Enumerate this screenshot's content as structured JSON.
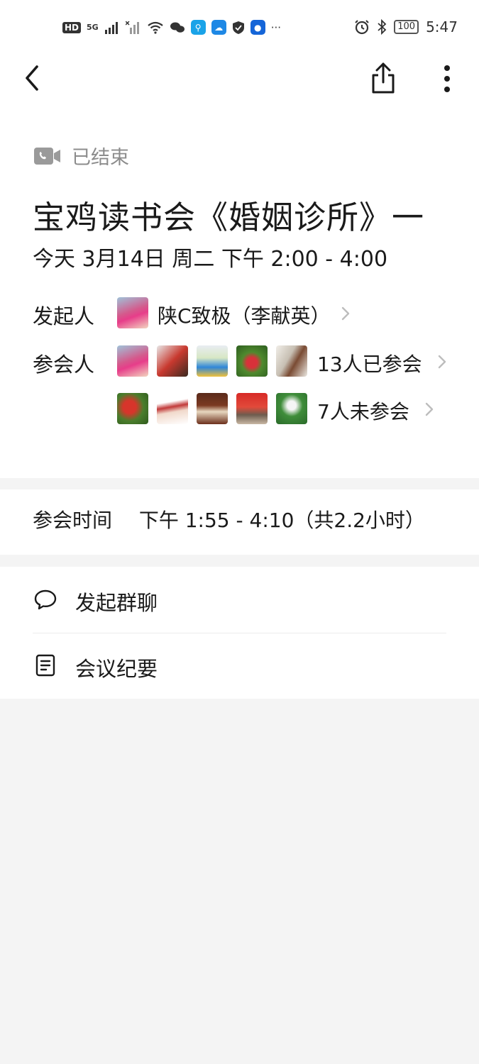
{
  "status_bar": {
    "hd": "HD",
    "signal": "5G",
    "time": "5:47",
    "battery": "100",
    "more": "···"
  },
  "meeting": {
    "state": "已结束",
    "title": "宝鸡读书会《婚姻诊所》一",
    "schedule": "今天 3月14日 周二 下午 2:00 - 4:00",
    "organizer_label": "发起人",
    "organizer_name": "陕C致极（李献英）",
    "participants_label": "参会人",
    "attended": "13人已参会",
    "not_attended": "7人未参会",
    "attend_time_label": "参会时间",
    "attend_time_value": "下午 1:55 - 4:10（共2.2小时）"
  },
  "actions": {
    "group_chat": "发起群聊",
    "minutes": "会议纪要"
  },
  "icons": {
    "back": "chevron-left-icon",
    "share": "share-icon",
    "more": "more-vertical-icon",
    "video": "video-call-icon",
    "chat": "chat-bubble-icon",
    "doc": "document-icon"
  },
  "colors": {
    "background": "#f4f4f4",
    "card": "#ffffff",
    "muted": "#8c8c8c"
  }
}
